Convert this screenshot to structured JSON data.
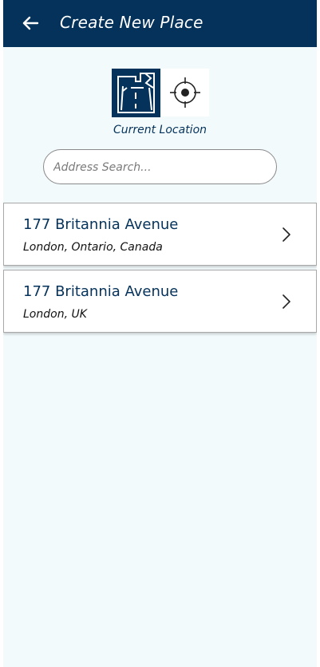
{
  "header": {
    "back_icon": "arrow-left-icon",
    "title": "Create New Place",
    "background": "#04325a"
  },
  "mode_toggle": {
    "map_icon": "map-icon",
    "location_icon": "crosshair-icon",
    "selected": "map",
    "caption": "Current Location"
  },
  "search": {
    "placeholder": "Address Search...",
    "value": ""
  },
  "results": [
    {
      "title": "177 Britannia Avenue",
      "subtitle": "London, Ontario, Canada",
      "icon": "chevron-right-icon"
    },
    {
      "title": "177 Britannia Avenue",
      "subtitle": "London, UK",
      "icon": "chevron-right-icon"
    }
  ]
}
